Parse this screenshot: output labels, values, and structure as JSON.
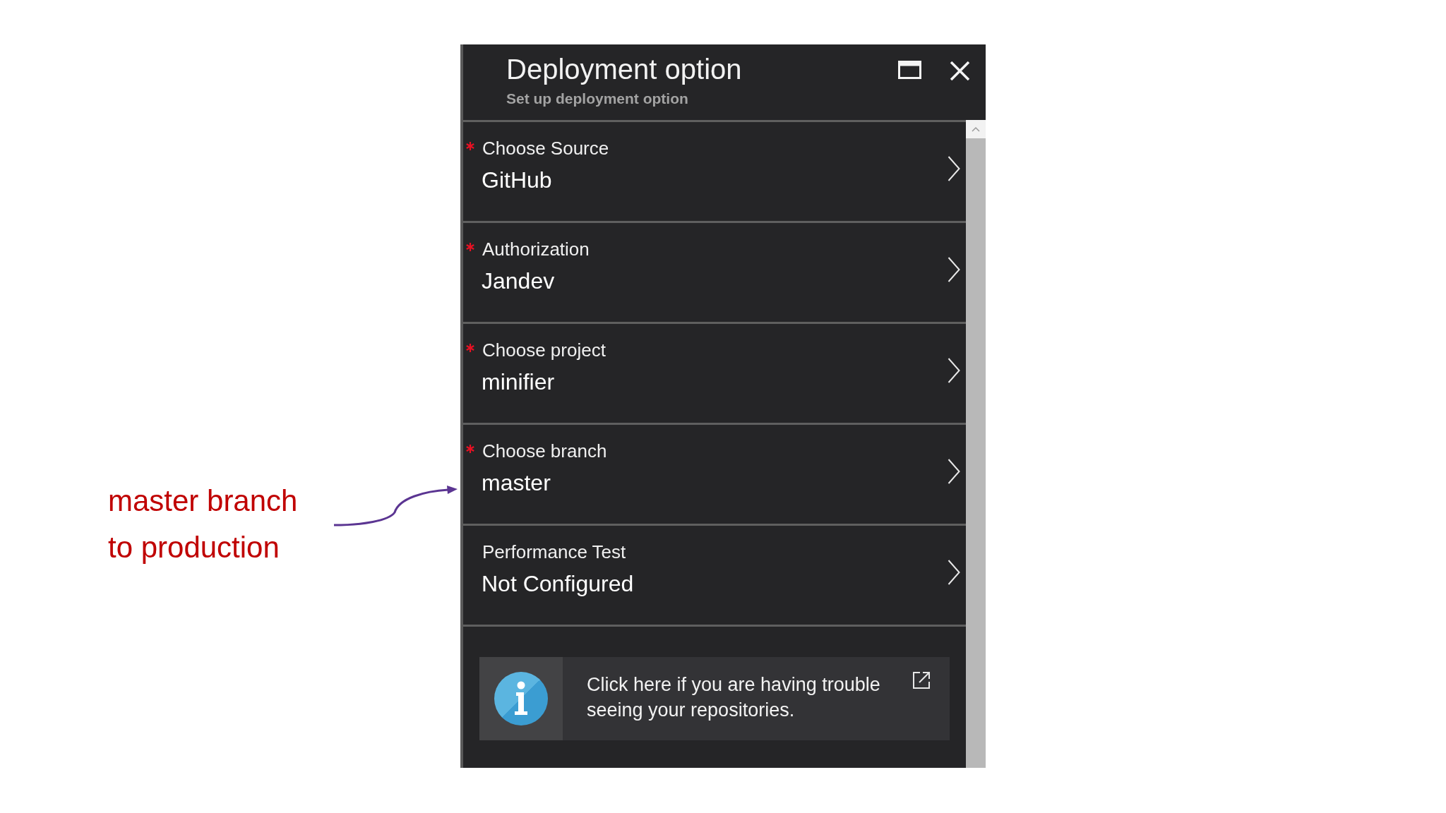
{
  "annotation": {
    "text": "master branch to production"
  },
  "panel": {
    "title": "Deployment option",
    "subtitle": "Set up deployment option"
  },
  "settings": [
    {
      "label": "Choose Source",
      "value": "GitHub",
      "required": true
    },
    {
      "label": "Authorization",
      "value": "Jandev",
      "required": true
    },
    {
      "label": "Choose project",
      "value": "minifier",
      "required": true
    },
    {
      "label": "Choose branch",
      "value": "master",
      "required": true
    },
    {
      "label": "Performance Test",
      "value": "Not Configured",
      "required": false
    }
  ],
  "info_box": {
    "text": "Click here if you are having trouble seeing your repositories."
  }
}
